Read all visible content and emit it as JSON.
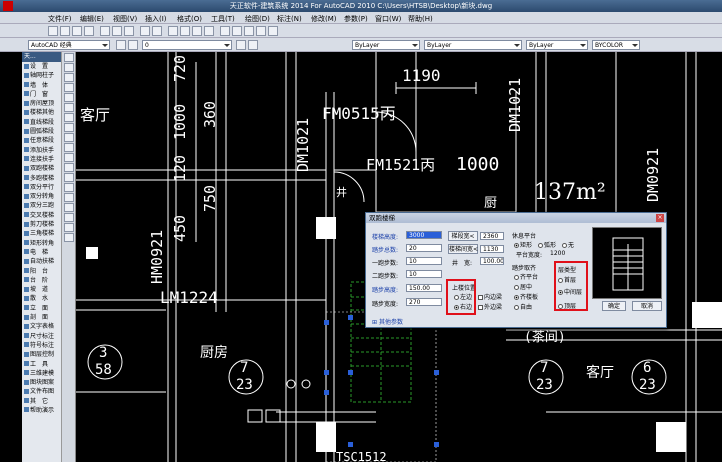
{
  "titlebar": {
    "title": "天正软件-建筑系统 2014  For AutoCAD 2010     C:\\Users\\HTSB\\Desktop\\新块.dwg"
  },
  "menu": [
    "文件(F)",
    "编辑(E)",
    "视图(V)",
    "插入(I)",
    "格式(O)",
    "工具(T)",
    "绘图(D)",
    "标注(N)",
    "修改(M)",
    "参数(P)",
    "窗口(W)",
    "帮助(H)"
  ],
  "toolbar": {
    "workspace": "AutoCAD 经典",
    "layer_value": "0",
    "color_value": "ByLayer",
    "linetype_value": "ByLayer",
    "lineweight_value": "ByLayer",
    "plotstyle_value": "BYCOLOR"
  },
  "left_panel": {
    "header": "天...",
    "items": [
      "设　置",
      "轴网柱子",
      "墙　体",
      "门　窗",
      "房间屋顶",
      "楼梯其他",
      "直线梯段",
      "圆弧梯段",
      "任意梯段",
      "添加扶手",
      "连接扶手",
      "双跑楼梯",
      "多跑楼梯",
      "双分平行",
      "双分转角",
      "双分三跑",
      "交叉楼梯",
      "剪刀楼梯",
      "三角楼梯",
      "矩形转角",
      "电　梯",
      "自动扶梯",
      "阳　台",
      "台　阶",
      "坡　道",
      "散　水",
      "立　面",
      "剖　面",
      "文字表格",
      "尺寸标注",
      "符号标注",
      "图层控制",
      "工　具",
      "三维建模",
      "图块图案",
      "文件布图",
      "其　它",
      "帮助演示"
    ]
  },
  "drawing": {
    "dims": [
      "1190",
      "1000",
      "720",
      "1000",
      "120",
      "360",
      "750",
      "450"
    ],
    "labels": [
      "FM0515丙",
      "FM1521丙",
      "DM1021",
      "DM1021",
      "DM0921",
      "HM0921",
      "LM1224",
      "厨房",
      "客厅",
      "客厅",
      "厨房",
      "(茶间)",
      "TSC1512",
      "137m²",
      "厨"
    ],
    "circles": [
      {
        "top": "3",
        "bottom": "58"
      },
      {
        "top": "7",
        "bottom": "23"
      },
      {
        "top": "7",
        "bottom": "23"
      },
      {
        "top": "6",
        "bottom": "23"
      }
    ],
    "stair_label": "井"
  },
  "dialog": {
    "title": "双跑楼梯",
    "close": "×",
    "stair_height_label": "楼梯高度:",
    "stair_height_value": "3000",
    "step_total_label": "踏步总数:",
    "step_total_value": "20",
    "first_run_label": "一跑步数:",
    "first_run_value": "10",
    "second_run_label": "二跑步数:",
    "second_run_value": "10",
    "step_height_label": "踏步高度:",
    "step_height_value": "150.00",
    "step_width_label": "踏步宽度:",
    "step_width_value": "270",
    "width_btn": "梯段宽<",
    "width_value": "2360",
    "total_width_btn": "楼梯间宽<",
    "total_width_value": "1130",
    "well_width_label": "井　宽:",
    "well_width_value": "100.00",
    "handrail_pos_title": "上楼位置",
    "left_label": "左边",
    "right_label": "右边",
    "inner_rail_label": "内边梁",
    "outer_rail_label": "外边梁",
    "landing_title": "休息平台",
    "rect_label": "矩形",
    "arc_label": "弧形",
    "none_label": "无",
    "landing_width_label": "平台宽度:",
    "landing_width_value": "1200",
    "align_title": "踏步取齐",
    "align_platform": "齐平台",
    "align_center": "居中",
    "align_landing": "齐楼板",
    "align_free": "自由",
    "layer_type_title": "层类型",
    "first_floor": "首层",
    "middle_floor": "中间层",
    "top_floor": "顶层",
    "ok": "确定",
    "cancel": "取消",
    "other_params": "其他参数"
  }
}
